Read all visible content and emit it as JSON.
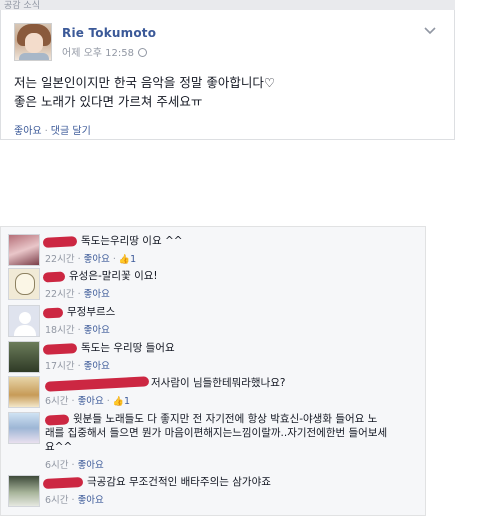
{
  "header": {
    "strip_text": "공감 소식"
  },
  "post": {
    "author": "Rie Tokumoto",
    "time": "어제 오후 12:58",
    "text_line1": "저는 일본인이지만 한국 음악을 정말 좋아합니다♡",
    "text_line2": "좋은 노래가 있다면 가르쳐 주세요ㅠ",
    "like_label": "좋아요",
    "separator": "·",
    "comment_label": "댓글 달기",
    "menu_icon": "chevron-down-icon"
  },
  "comments": [
    {
      "text": "독도는우리땅 이요 ^^",
      "time": "22시간",
      "like_label": "좋아요",
      "like_count": "1"
    },
    {
      "text": "유성은-말리꽃 이요!",
      "time": "22시간",
      "like_label": "좋아요"
    },
    {
      "text": "무정부르스",
      "time": "18시간",
      "like_label": "좋아요"
    },
    {
      "text": "독도는 우리땅 들어요",
      "time": "17시간",
      "like_label": "좋아요"
    },
    {
      "text": "저사람이 님들한테뭐라했나요?",
      "time": "6시간",
      "like_label": "좋아요",
      "like_count": "1"
    },
    {
      "text_line1": "윗분들 노래들도 다 좋지만 전 자기전에 항상 박효신-야생화 들어요 노",
      "text_line2": "래를 집중해서 들으면 뭔가 마음이편해지는느낌이랄까..자기전에한번 들어보세",
      "text_line3": "요^^",
      "time": "6시간",
      "like_label": "좋아요"
    },
    {
      "text": "극공감요 무조건적인 배타주의는 삼가야죠",
      "time": "6시간",
      "like_label": "좋아요"
    }
  ],
  "colors": {
    "link": "#3b5998",
    "meta": "#9197a3",
    "redaction": "#c8102e",
    "panel": "#f6f7f9"
  }
}
